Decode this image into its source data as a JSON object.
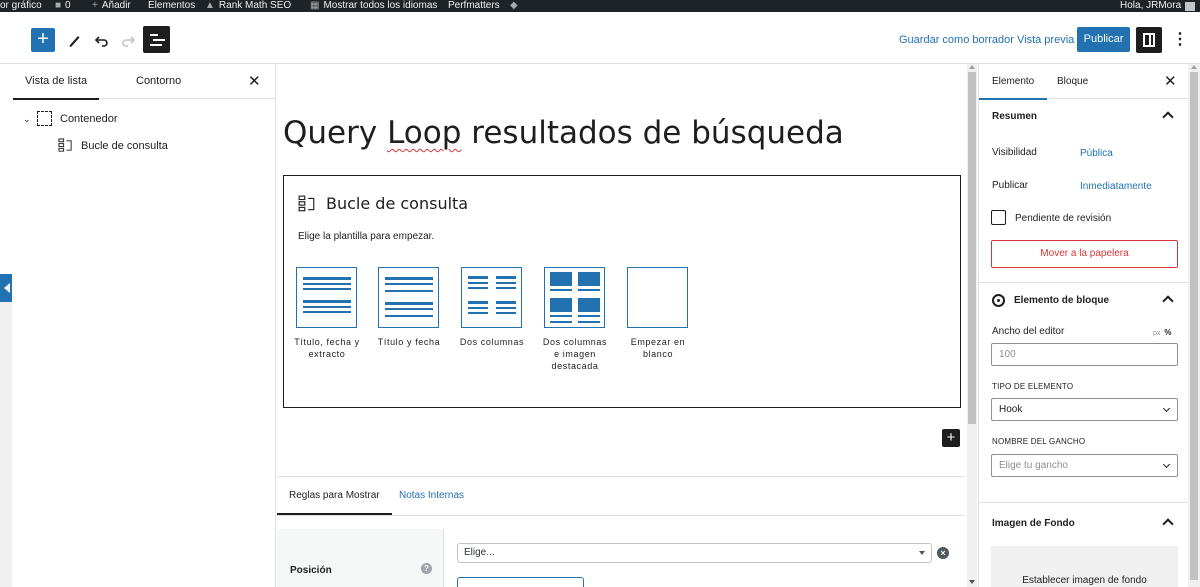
{
  "admin_bar": {
    "graph_label": "or gráfico",
    "comments_count": "0",
    "add_new": "Añadir",
    "elements": "Elementos",
    "rank_math": "Rank Math SEO",
    "languages": "Mostrar todos los idiomas",
    "perfmatters": "Perfmatters",
    "greeting": "Hola, JRMora"
  },
  "header": {
    "save_draft": "Guardar como borrador",
    "preview": "Vista previa",
    "publish": "Publicar"
  },
  "list_view": {
    "tabs": [
      "Vista de lista",
      "Contorno"
    ],
    "items": [
      {
        "label": "Contenedor"
      },
      {
        "label": "Bucle de consulta"
      }
    ]
  },
  "canvas": {
    "title_before": "Query ",
    "title_misspelled": "Loop",
    "title_after": " resultados de búsqueda",
    "block_title": "Bucle de consulta",
    "instruction": "Elige la plantilla para empezar.",
    "patterns": [
      {
        "label": "Título, fecha y extracto"
      },
      {
        "label": "Título y fecha"
      },
      {
        "label": "Dos columnas"
      },
      {
        "label": "Dos columnas e imagen destacada"
      },
      {
        "label": "Empezar en blanco"
      }
    ]
  },
  "meta": {
    "tabs": [
      "Reglas para Mostrar",
      "Notas Internas"
    ],
    "position_label": "Posición",
    "select_placeholder": "Elige..."
  },
  "sidebar": {
    "tabs": [
      "Elemento",
      "Bloque"
    ],
    "summary": {
      "title": "Resumen",
      "visibility_label": "Visibilidad",
      "visibility_value": "Pública",
      "publish_label": "Publicar",
      "publish_value": "Inmediatamente",
      "pending_label": "Pendiente de revisión",
      "trash": "Mover a la papelera"
    },
    "block_element": {
      "title": "Elemento de bloque",
      "editor_width_label": "Ancho del editor",
      "unit_px": "px",
      "unit_pct": "%",
      "editor_width_placeholder": "100",
      "element_type_label": "TIPO DE ELEMENTO",
      "element_type_value": "Hook",
      "hook_name_label": "NOMBRE DEL GANCHO",
      "hook_name_placeholder": "Elige tu gancho"
    },
    "background": {
      "title": "Imagen de Fondo",
      "set_image": "Establecer imagen de fondo"
    }
  },
  "colors": {
    "accent": "#2271b1",
    "dark": "#1e1e1e",
    "danger": "#d63638",
    "admin_bar": "#1d2327"
  },
  "icons": {
    "inserter": "plus-icon",
    "tools": "pencil-icon",
    "undo": "undo-icon",
    "redo": "redo-icon",
    "list_view": "list-view-icon",
    "settings": "sidebar-toggle-icon",
    "more": "vertical-ellipsis-icon"
  }
}
